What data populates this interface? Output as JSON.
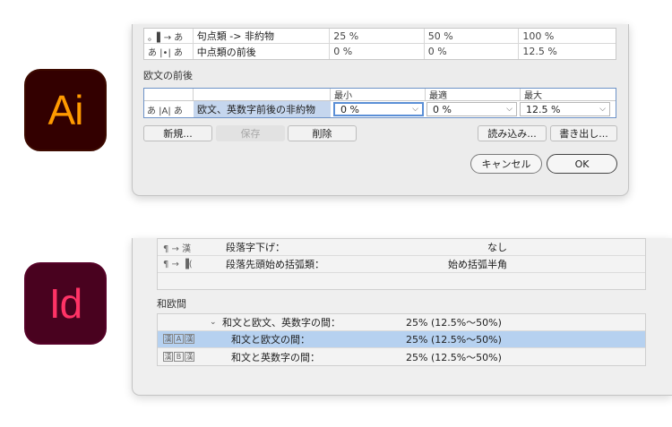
{
  "ai_logo": "Ai",
  "id_logo": "Id",
  "ai": {
    "top_rows": [
      {
        "icon": "。▌→ あ",
        "name": "句点類 -> 非約物",
        "min": "25 %",
        "opt": "50 %",
        "max": "100 %"
      },
      {
        "icon": "あ |•| あ",
        "name": "中点類の前後",
        "min": "0 %",
        "opt": "0 %",
        "max": "12.5 %"
      }
    ],
    "section_label": "欧文の前後",
    "alpha_headers": {
      "min": "最小",
      "opt": "最適",
      "max": "最大"
    },
    "alpha_row": {
      "icon": "あ |A| あ",
      "name": "欧文、英数字前後の非約物",
      "min": "0 %",
      "opt": "0 %",
      "max": "12.5 %"
    },
    "buttons": {
      "new": "新規...",
      "save": "保存",
      "delete": "削除",
      "import": "読み込み...",
      "export": "書き出し...",
      "cancel": "キャンセル",
      "ok": "OK"
    }
  },
  "indesign": {
    "top_rows": [
      {
        "icon": "¶ → 漢",
        "name": "段落字下げ：",
        "value": "なし"
      },
      {
        "icon": "¶ → ▐(",
        "name": "段落先頭始め括弧類：",
        "value": "始め括弧半角"
      }
    ],
    "section_label": "和欧間",
    "group_label": "和文と欧文、英数字の間：",
    "group_value": "25% (12.5%〜50%)",
    "rows": [
      {
        "i1": "漢",
        "i2": "A",
        "i3": "漢",
        "name": "和文と欧文の間：",
        "value": "25% (12.5%〜50%)"
      },
      {
        "i1": "漢",
        "i2": "B",
        "i3": "漢",
        "name": "和文と英数字の間：",
        "value": "25% (12.5%〜50%)"
      }
    ]
  }
}
